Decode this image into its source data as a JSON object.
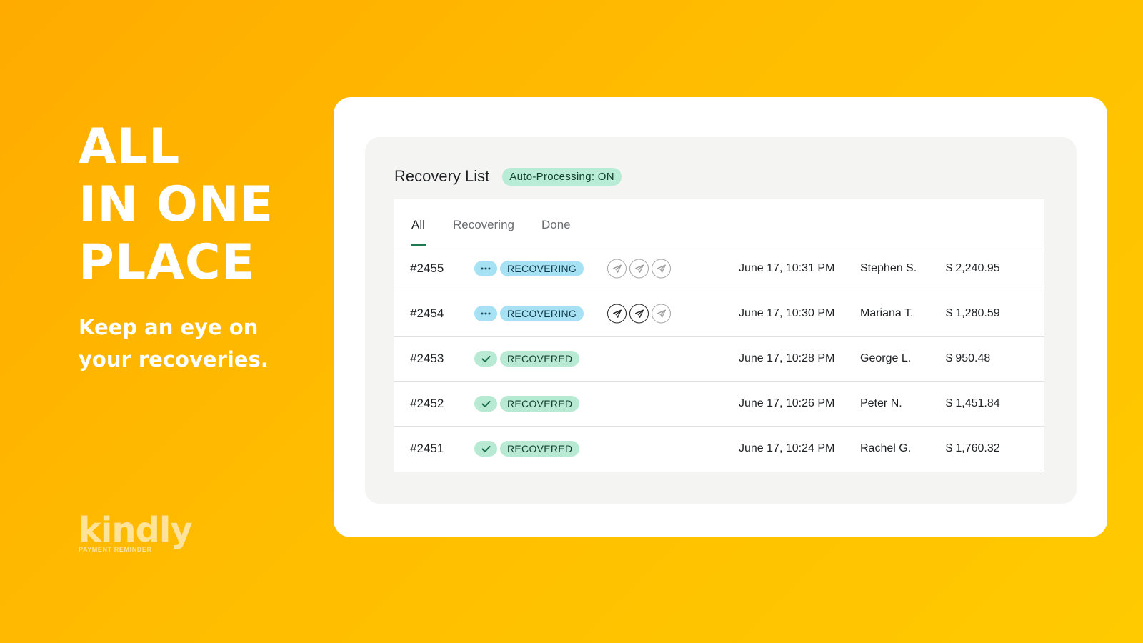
{
  "hero": {
    "headline": [
      "ALL",
      "IN ONE",
      "PLACE"
    ],
    "subline": [
      "Keep an eye on",
      "your recoveries."
    ]
  },
  "logo": {
    "word": "kindly",
    "tagline": "PAYMENT REMINDER"
  },
  "panel": {
    "title": "Recovery List",
    "auto_badge": "Auto-Processing: ON",
    "tabs": [
      {
        "label": "All",
        "active": true
      },
      {
        "label": "Recovering",
        "active": false
      },
      {
        "label": "Done",
        "active": false
      }
    ],
    "rows": [
      {
        "id": "#2455",
        "status": "RECOVERING",
        "status_icon": "more-dots-icon",
        "channels": [
          "pending",
          "pending",
          "pending"
        ],
        "date": "June 17, 10:31 PM",
        "customer": "Stephen S.",
        "amount": "$ 2,240.95"
      },
      {
        "id": "#2454",
        "status": "RECOVERING",
        "status_icon": "more-dots-icon",
        "channels": [
          "sent",
          "sent",
          "pending"
        ],
        "date": "June 17, 10:30 PM",
        "customer": "Mariana T.",
        "amount": "$ 1,280.59"
      },
      {
        "id": "#2453",
        "status": "RECOVERED",
        "status_icon": "check-icon",
        "channels": [],
        "date": "June 17, 10:28 PM",
        "customer": "George L.",
        "amount": "$ 950.48"
      },
      {
        "id": "#2452",
        "status": "RECOVERED",
        "status_icon": "check-icon",
        "channels": [],
        "date": "June 17, 10:26 PM",
        "customer": "Peter N.",
        "amount": "$ 1,451.84"
      },
      {
        "id": "#2451",
        "status": "RECOVERED",
        "status_icon": "check-icon",
        "channels": [],
        "date": "June 17, 10:24 PM",
        "customer": "Rachel G.",
        "amount": "$ 1,760.32"
      }
    ]
  },
  "colors": {
    "background_start": "#ffab00",
    "background_end": "#ffca00",
    "accent_green": "#1b7a52",
    "recovering_badge": "#a6e2f4",
    "recovered_badge": "#b7e9d3"
  }
}
